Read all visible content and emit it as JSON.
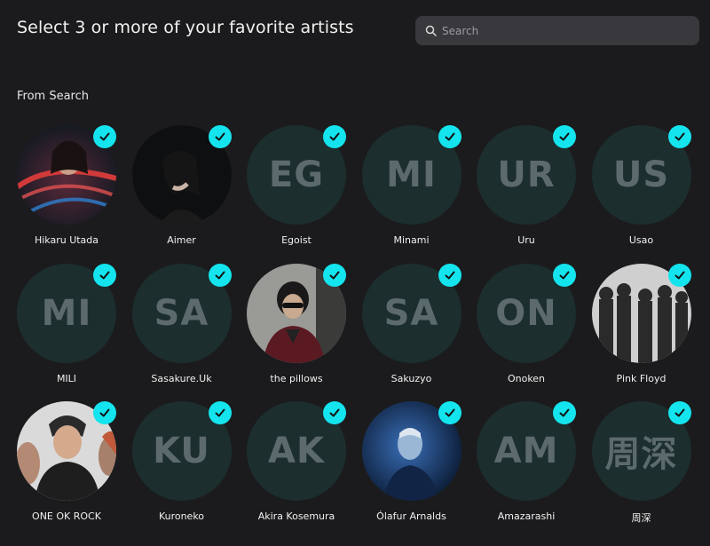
{
  "header": {
    "title": "Select 3 or more of your favorite artists",
    "search_placeholder": "Search"
  },
  "section_label": "From Search",
  "colors": {
    "background": "#1b1b1d",
    "accent_check": "#14e4ee",
    "avatar_placeholder": "#1c2e2e",
    "initials": "#5d6a6d",
    "search_bg": "#38383d"
  },
  "artists": [
    {
      "name": "Hikaru Utada",
      "initials": "",
      "selected": true,
      "photo": true
    },
    {
      "name": "Aimer",
      "initials": "",
      "selected": true,
      "photo": true
    },
    {
      "name": "Egoist",
      "initials": "EG",
      "selected": true,
      "photo": false
    },
    {
      "name": "Minami",
      "initials": "MI",
      "selected": true,
      "photo": false
    },
    {
      "name": "Uru",
      "initials": "UR",
      "selected": true,
      "photo": false
    },
    {
      "name": "Usao",
      "initials": "US",
      "selected": true,
      "photo": false
    },
    {
      "name": "MILI",
      "initials": "MI",
      "selected": true,
      "photo": false
    },
    {
      "name": "Sasakure.Uk",
      "initials": "SA",
      "selected": true,
      "photo": false
    },
    {
      "name": "the pillows",
      "initials": "",
      "selected": true,
      "photo": true
    },
    {
      "name": "Sakuzyo",
      "initials": "SA",
      "selected": true,
      "photo": false
    },
    {
      "name": "Onoken",
      "initials": "ON",
      "selected": true,
      "photo": false
    },
    {
      "name": "Pink Floyd",
      "initials": "",
      "selected": true,
      "photo": true
    },
    {
      "name": "ONE OK ROCK",
      "initials": "",
      "selected": true,
      "photo": true
    },
    {
      "name": "Kuroneko",
      "initials": "KU",
      "selected": true,
      "photo": false
    },
    {
      "name": "Akira Kosemura",
      "initials": "AK",
      "selected": true,
      "photo": false
    },
    {
      "name": "Ólafur Arnalds",
      "initials": "",
      "selected": true,
      "photo": true
    },
    {
      "name": "Amazarashi",
      "initials": "AM",
      "selected": true,
      "photo": false
    },
    {
      "name": "周深",
      "initials": "周深",
      "selected": true,
      "photo": false
    }
  ]
}
